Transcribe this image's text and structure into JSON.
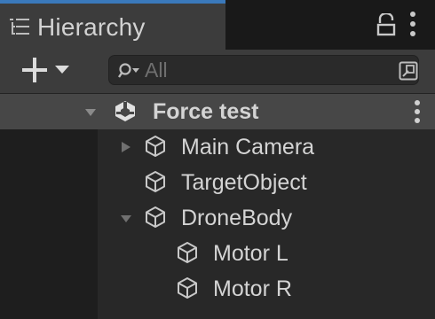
{
  "panel": {
    "tab_title": "Hierarchy",
    "tab_icon": "list-icon",
    "accent": "#3a79bb"
  },
  "toolbar": {
    "create_icon": "plus-icon",
    "dropdown_icon": "triangle-down-icon",
    "search_placeholder": "All",
    "search_icon": "search-filter-icon",
    "search_options_icon": "search-options-icon"
  },
  "scene": {
    "label": "Force test",
    "icon": "unity-scene-icon",
    "expanded": true
  },
  "tree": [
    {
      "label": "Main Camera",
      "depth": 1,
      "foldout": "collapsed",
      "icon": "gameobject-cube-icon"
    },
    {
      "label": "TargetObject",
      "depth": 1,
      "foldout": "none",
      "icon": "gameobject-cube-icon"
    },
    {
      "label": "DroneBody",
      "depth": 1,
      "foldout": "expanded",
      "icon": "gameobject-cube-icon"
    },
    {
      "label": "Motor L",
      "depth": 2,
      "foldout": "none",
      "icon": "gameobject-cube-icon"
    },
    {
      "label": "Motor R",
      "depth": 2,
      "foldout": "none",
      "icon": "gameobject-cube-icon"
    }
  ]
}
